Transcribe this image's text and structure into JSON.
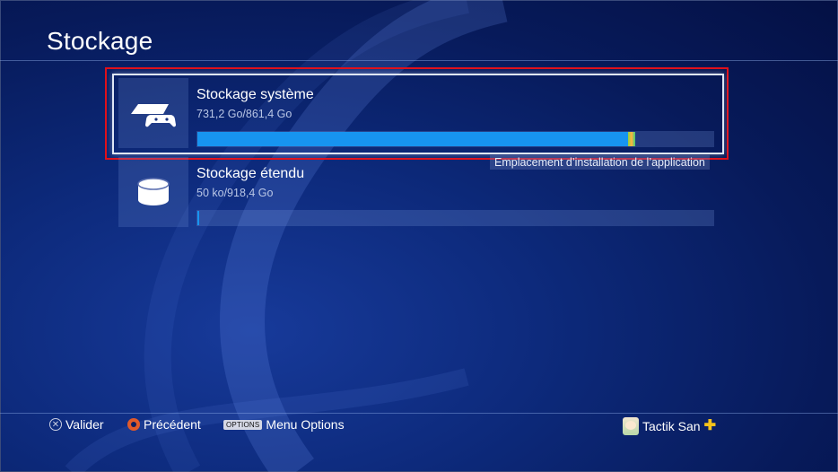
{
  "header": {
    "title": "Stockage"
  },
  "storage_items": [
    {
      "title": "Stockage système",
      "usage": "731,2 Go/861,4 Go",
      "used_fraction": 0.849,
      "icon": "console-controller-icon"
    },
    {
      "title": "Stockage étendu",
      "usage": "50 ko/918,4 Go",
      "used_fraction": 0.003,
      "badge": "Emplacement d’installation de l’application",
      "icon": "extended-storage-drive-icon"
    }
  ],
  "footer": {
    "confirm_label": "Valider",
    "back_label": "Précédent",
    "options_key": "OPTIONS",
    "options_label": "Menu Options",
    "user_name": "Tactik San",
    "confirm_icon": "cross-button-icon",
    "back_icon": "circle-button-icon",
    "plus_icon": "playstation-plus-icon"
  },
  "colors": {
    "highlight": "#e0101a",
    "bar_fill": "#1794f0",
    "background": "#0d2a7c"
  }
}
